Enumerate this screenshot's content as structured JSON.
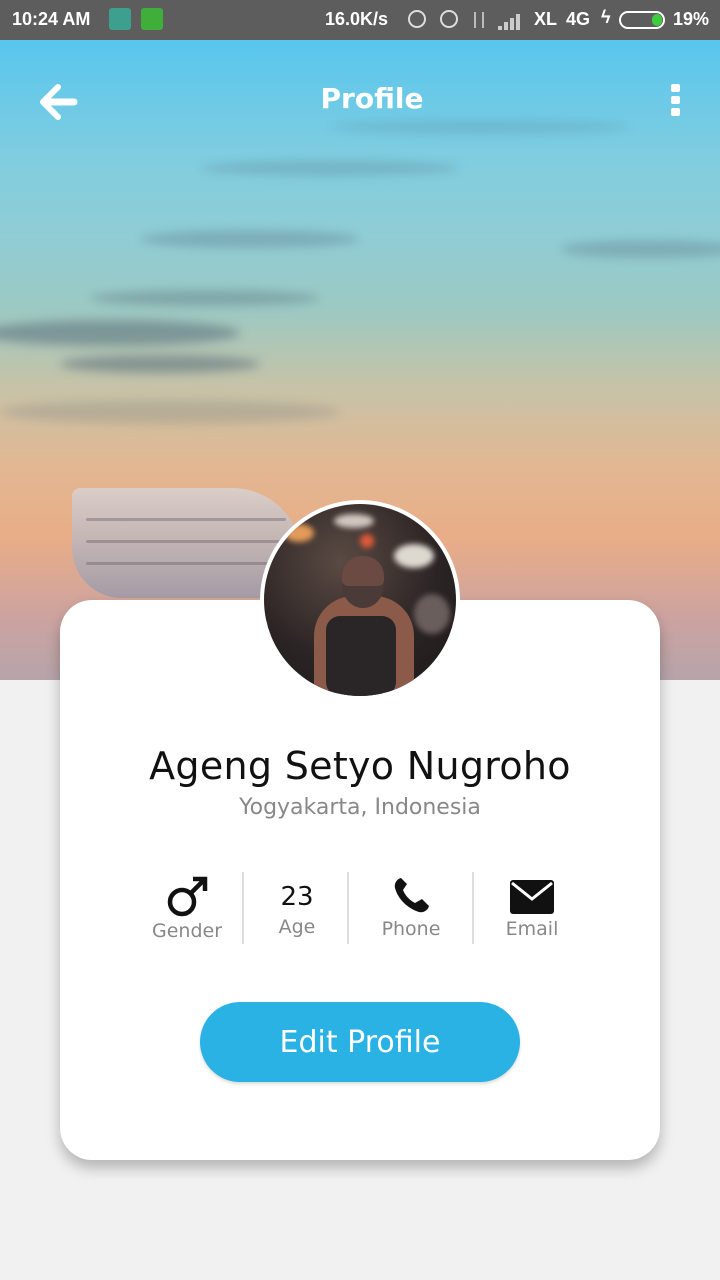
{
  "status_bar": {
    "time": "10:24 AM",
    "net_speed": "16.0K/s",
    "carrier": "XL",
    "network": "4G",
    "battery": "19%",
    "battery_level": 0.19
  },
  "topbar": {
    "title": "Profile",
    "back_icon": "arrow-left-icon",
    "menu_icon": "more-vertical-icon"
  },
  "profile": {
    "name": "Ageng Setyo Nugroho",
    "location": "Yogyakarta, Indonesia"
  },
  "stats": {
    "gender_label": "Gender",
    "age_value": "23",
    "age_label": "Age",
    "phone_label": "Phone",
    "email_label": "Email"
  },
  "actions": {
    "edit_label": "Edit Profile"
  },
  "colors": {
    "accent": "#29b2e3",
    "status_bar": "#5d5d5d",
    "background": "#f1f1f1"
  }
}
